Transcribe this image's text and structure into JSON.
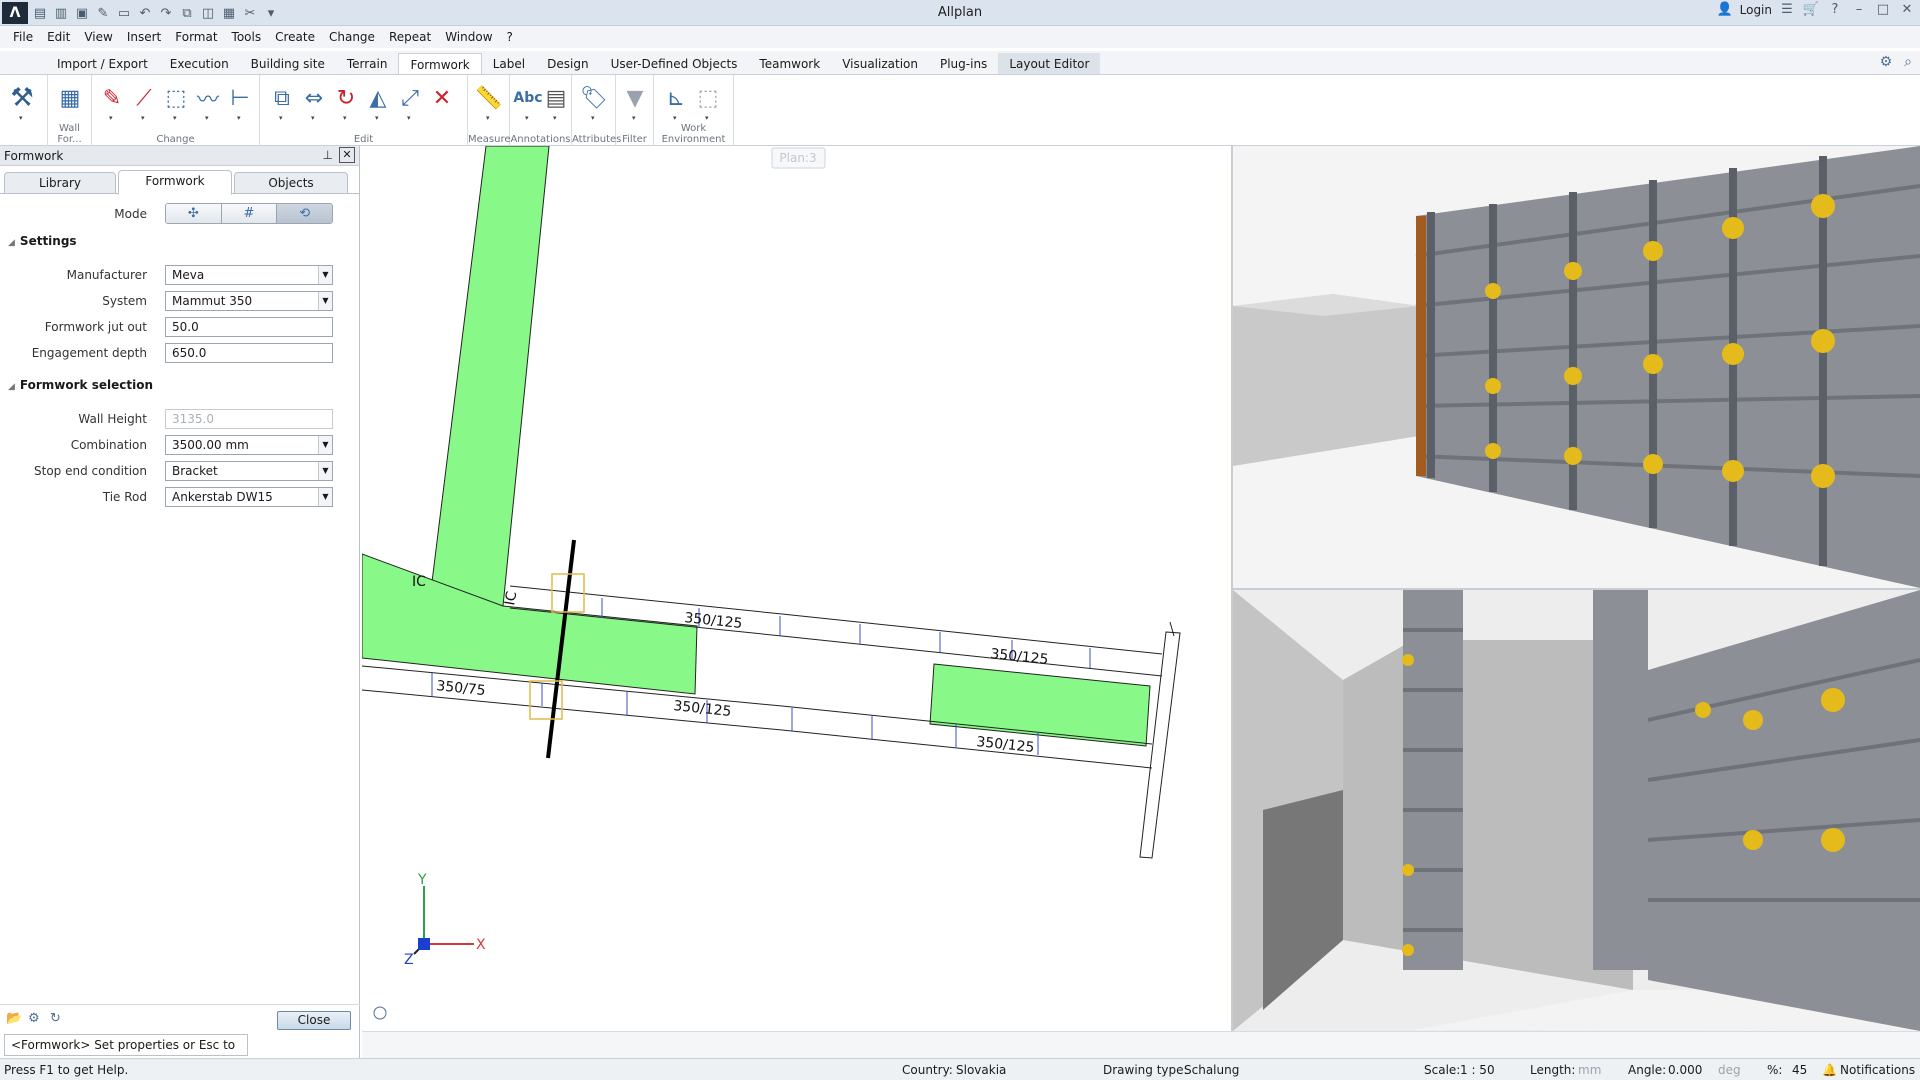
{
  "app": {
    "title": "Allplan",
    "login": "Login"
  },
  "menu": [
    "File",
    "Edit",
    "View",
    "Insert",
    "Format",
    "Tools",
    "Create",
    "Change",
    "Repeat",
    "Window",
    "?"
  ],
  "ribbon_tabs": [
    "Import / Export",
    "Execution",
    "Building site",
    "Terrain",
    "Formwork",
    "Label",
    "Design",
    "User-Defined Objects",
    "Teamwork",
    "Visualization",
    "Plug-ins",
    "Layout Editor"
  ],
  "ribbon_active": "Formwork",
  "ribbon_groups": {
    "wall": "Wall For...",
    "change": "Change",
    "edit": "Edit",
    "measure": "Measure",
    "annotations": "Annotations",
    "attributes": "Attributes",
    "filter": "Filter",
    "work_env": "Work Environment"
  },
  "panel": {
    "title": "Formwork",
    "tabs": [
      "Library",
      "Formwork",
      "Objects"
    ],
    "mode_label": "Mode",
    "settings_title": "Settings",
    "manufacturer": {
      "label": "Manufacturer",
      "value": "Meva"
    },
    "system": {
      "label": "System",
      "value": "Mammut 350"
    },
    "jut_out": {
      "label": "Formwork jut out",
      "value": "50.0"
    },
    "engagement": {
      "label": "Engagement depth",
      "value": "650.0"
    },
    "selection_title": "Formwork selection",
    "wall_height": {
      "label": "Wall Height",
      "value": "3135.0"
    },
    "combination": {
      "label": "Combination",
      "value": "3500.00 mm"
    },
    "stop_end": {
      "label": "Stop end condition",
      "value": "Bracket"
    },
    "tie_rod": {
      "label": "Tie Rod",
      "value": "Ankerstab DW15"
    },
    "close_label": "Close",
    "prompt": "<Formwork> Set properties or Esc to quit"
  },
  "viewport": {
    "plan_label": "Plan:3",
    "labels": {
      "ic1": "IC",
      "ic2": "IC",
      "p1": "350/125",
      "p2": "350/125",
      "p3": "350/75",
      "p4": "350/125",
      "p5": "350/125"
    },
    "axes": {
      "y": "Y",
      "x": "X",
      "z": "Z"
    }
  },
  "status": {
    "help": "Press F1 to get Help.",
    "country_label": "Country:",
    "country": "Slovakia",
    "dtype_label": "Drawing type:",
    "dtype": "Schalung",
    "scale_label": "Scale:",
    "scale": "1 : 50",
    "length_label": "Length:",
    "length_unit": "mm",
    "angle_label": "Angle:",
    "angle": "0.000",
    "angle_unit": "deg",
    "pct_label": "%:",
    "pct": "45",
    "notifications": "Notifications"
  }
}
